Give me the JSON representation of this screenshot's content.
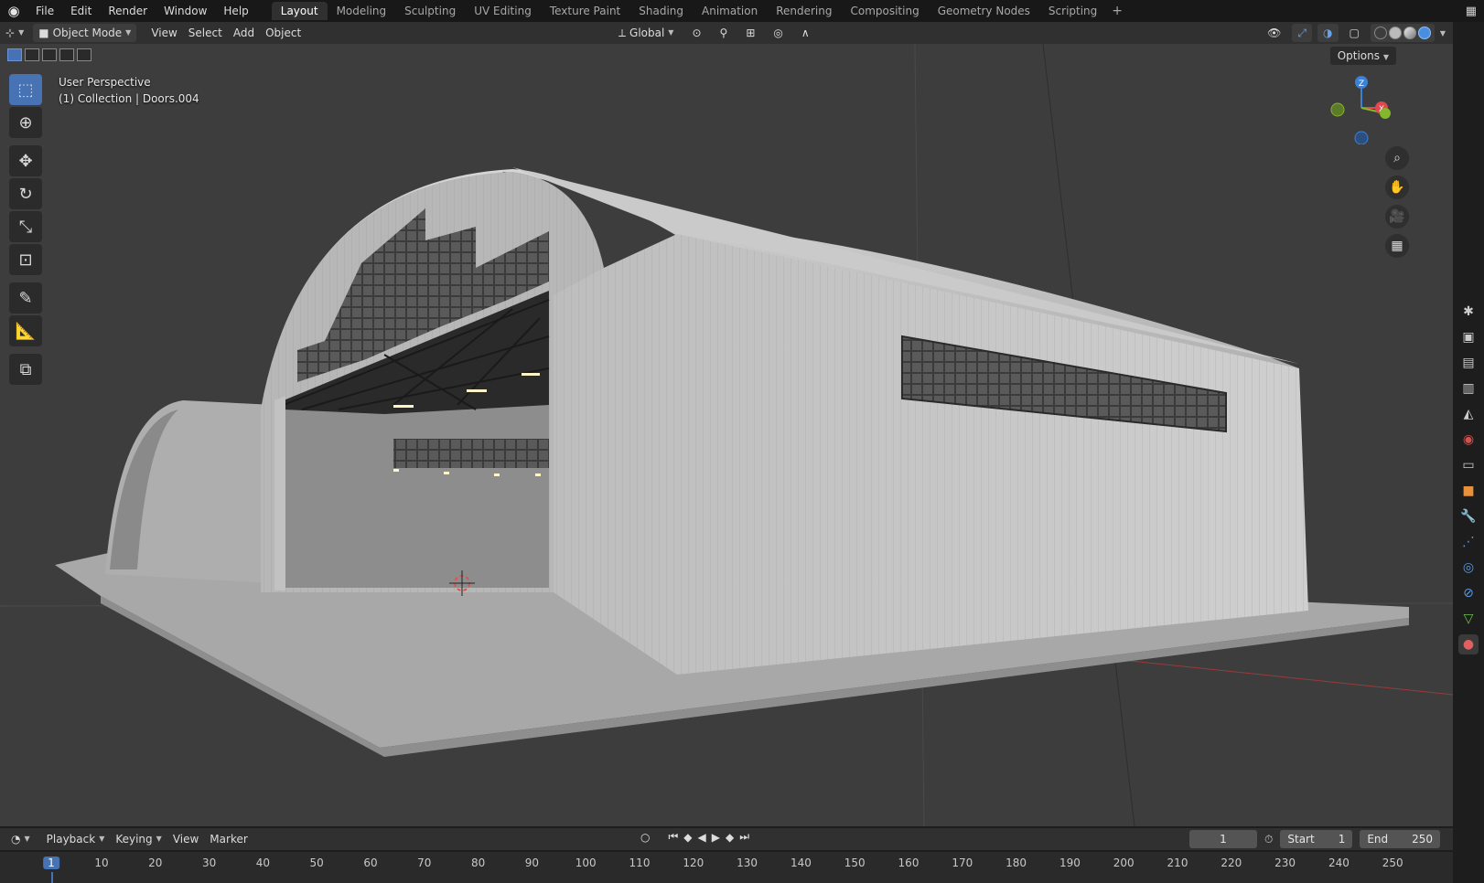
{
  "topbar": {
    "menus": [
      "File",
      "Edit",
      "Render",
      "Window",
      "Help"
    ],
    "workspaces": [
      "Layout",
      "Modeling",
      "Sculpting",
      "UV Editing",
      "Texture Paint",
      "Shading",
      "Animation",
      "Rendering",
      "Compositing",
      "Geometry Nodes",
      "Scripting"
    ],
    "active_workspace": "Layout",
    "add_label": "+"
  },
  "viewport_header": {
    "mode": "Object Mode",
    "menus": [
      "View",
      "Select",
      "Add",
      "Object"
    ],
    "orientation": "Global"
  },
  "viewport": {
    "perspective_label": "User Perspective",
    "collection_label": "(1) Collection | Doors.004",
    "options_label": "Options",
    "gizmo_axes": [
      "Z",
      "X"
    ]
  },
  "timeline": {
    "menus": [
      "Playback",
      "Keying",
      "View",
      "Marker"
    ],
    "current_frame": "1",
    "start_label": "Start",
    "start_value": "1",
    "end_label": "End",
    "end_value": "250",
    "ticks": [
      "1",
      "10",
      "20",
      "30",
      "40",
      "50",
      "60",
      "70",
      "80",
      "90",
      "100",
      "110",
      "120",
      "130",
      "140",
      "150",
      "160",
      "170",
      "180",
      "190",
      "200",
      "210",
      "220",
      "230",
      "240",
      "250"
    ]
  },
  "colors": {
    "accent": "#4772b3",
    "axis_x": "#e0474f",
    "axis_y": "#82b82a",
    "axis_z": "#3b82d6"
  },
  "icons": {
    "logo": "blender-logo-icon",
    "tools": [
      "select-box-icon",
      "cursor-icon",
      "move-icon",
      "rotate-icon",
      "scale-icon",
      "transform-icon",
      "annotate-icon",
      "measure-icon",
      "add-cube-icon"
    ],
    "nav": [
      "zoom-icon",
      "pan-hand-icon",
      "camera-icon",
      "grid-view-icon"
    ],
    "properties": [
      "tool-icon",
      "render-icon",
      "output-icon",
      "view-layer-icon",
      "scene-icon",
      "world-icon",
      "collection-icon",
      "object-icon",
      "modifier-icon",
      "particles-icon",
      "physics-icon",
      "constraints-icon",
      "data-icon",
      "material-icon"
    ]
  }
}
